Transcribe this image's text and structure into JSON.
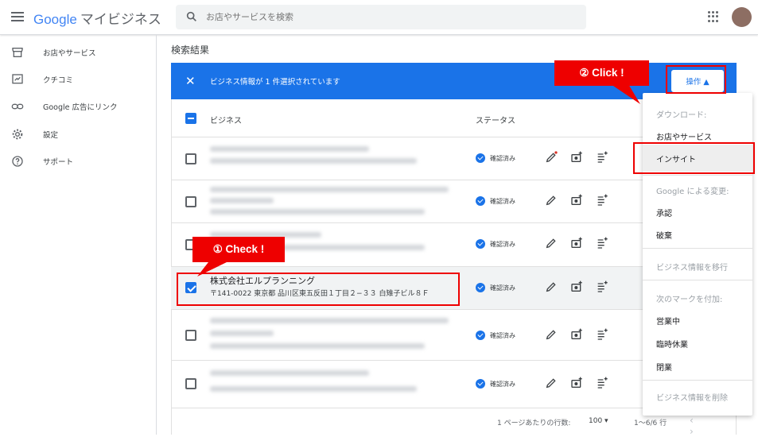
{
  "header": {
    "logo": "Google",
    "product": "マイビジネス",
    "search_placeholder": "お店やサービスを検索"
  },
  "sidebar": {
    "items": [
      {
        "label": "お店やサービス",
        "icon": "store-icon"
      },
      {
        "label": "クチコミ",
        "icon": "review-icon"
      },
      {
        "label": "Google 広告にリンク",
        "icon": "link-icon"
      },
      {
        "label": "設定",
        "icon": "gear-icon"
      },
      {
        "label": "サポート",
        "icon": "help-icon"
      }
    ]
  },
  "main": {
    "title": "検索結果",
    "selection_text": "ビジネス情報が 1 件選択されています",
    "operations_label": "操作 ▲",
    "col_business": "ビジネス",
    "col_status": "ステータス",
    "status_verified": "確認済み",
    "selected_business": {
      "name": "株式会社エルプランニング",
      "address": "〒141-0022 東京都 品川区東五反田１丁目２−３３ 白雉子ビル８Ｆ"
    }
  },
  "footer": {
    "rows_per_page_label": "1 ページあたりの行数:",
    "rows_per_page": "100 ▾",
    "range": "1〜6/6 行",
    "nav": "‹ ›"
  },
  "menu": {
    "download_header": "ダウンロード:",
    "item_locations": "お店やサービス",
    "item_insights": "インサイト",
    "google_changes_header": "Google による変更:",
    "item_approve": "承認",
    "item_discard": "破棄",
    "item_transfer": "ビジネス情報を移行",
    "mark_header": "次のマークを付加:",
    "item_open": "営業中",
    "item_temp_closed": "臨時休業",
    "item_closed": "閉業",
    "item_delete": "ビジネス情報を削除"
  },
  "annotations": {
    "callout_check": "① Check !",
    "callout_click": "② Click !"
  },
  "colors": {
    "accent": "#1a73e8",
    "annotation_red": "#e00000"
  }
}
